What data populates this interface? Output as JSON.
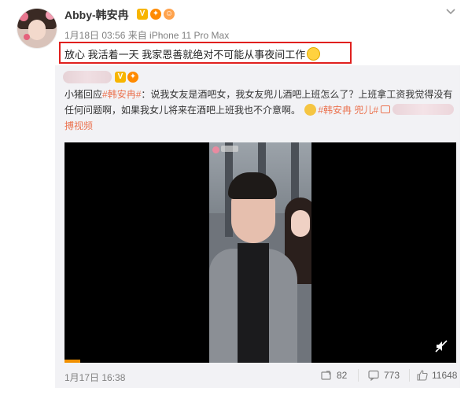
{
  "header": {
    "username": "Abby-韩安冉",
    "meta": "1月18日 03:56 来自 iPhone 11 Pro Max"
  },
  "post": {
    "text": "放心 我活着一天 我家恩善就绝对不可能从事夜间工作"
  },
  "repost": {
    "prefix": "小猪回应",
    "tag1": "#韩安冉#",
    "body1": "：说我女友是酒吧女，我女友兜儿酒吧上班怎么了？上班拿工资我觉得没有任何问题啊，如果我女儿将来在酒吧上班我也不介意啊。",
    "tag2": "#韩安冉",
    "tag3": "兜儿#",
    "line3": "搏视频",
    "date": "1月17日 16:38",
    "shares": "82",
    "comments": "773",
    "likes": "11648"
  },
  "colors": {
    "accent": "#eb7350",
    "highlight_border": "#e0201e",
    "progress": "#f08f00"
  },
  "icons": {
    "chevron": "chevron-down-icon",
    "share": "share-icon",
    "comment": "comment-icon",
    "like": "thumbs-up-icon",
    "mute": "mute-icon"
  }
}
